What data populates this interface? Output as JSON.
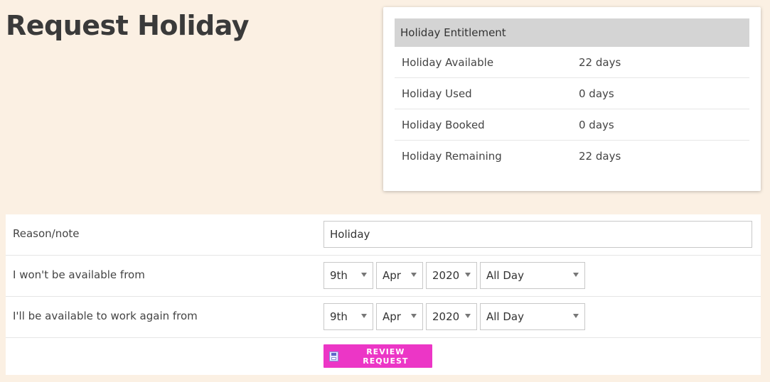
{
  "page": {
    "title": "Request Holiday"
  },
  "entitlement": {
    "header": "Holiday Entitlement",
    "rows": [
      {
        "label": "Holiday Available",
        "value": "22 days"
      },
      {
        "label": "Holiday Used",
        "value": "0 days"
      },
      {
        "label": "Holiday Booked",
        "value": "0 days"
      },
      {
        "label": "Holiday Remaining",
        "value": "22 days"
      }
    ]
  },
  "form": {
    "reason": {
      "label": "Reason/note",
      "value": "Holiday"
    },
    "from": {
      "label": "I won't be available from",
      "day": "9th",
      "month": "Apr",
      "year": "2020",
      "period": "All Day"
    },
    "to": {
      "label": "I'll be available to work again from",
      "day": "9th",
      "month": "Apr",
      "year": "2020",
      "period": "All Day"
    },
    "review_button": "REVIEW REQUEST"
  },
  "icons": {
    "review_button_icon": "save-icon",
    "select_caret": "chevron-down-icon"
  },
  "colors": {
    "background": "#fbf0e3",
    "accent": "#ec36c6",
    "table_header": "#d4d4d4"
  }
}
